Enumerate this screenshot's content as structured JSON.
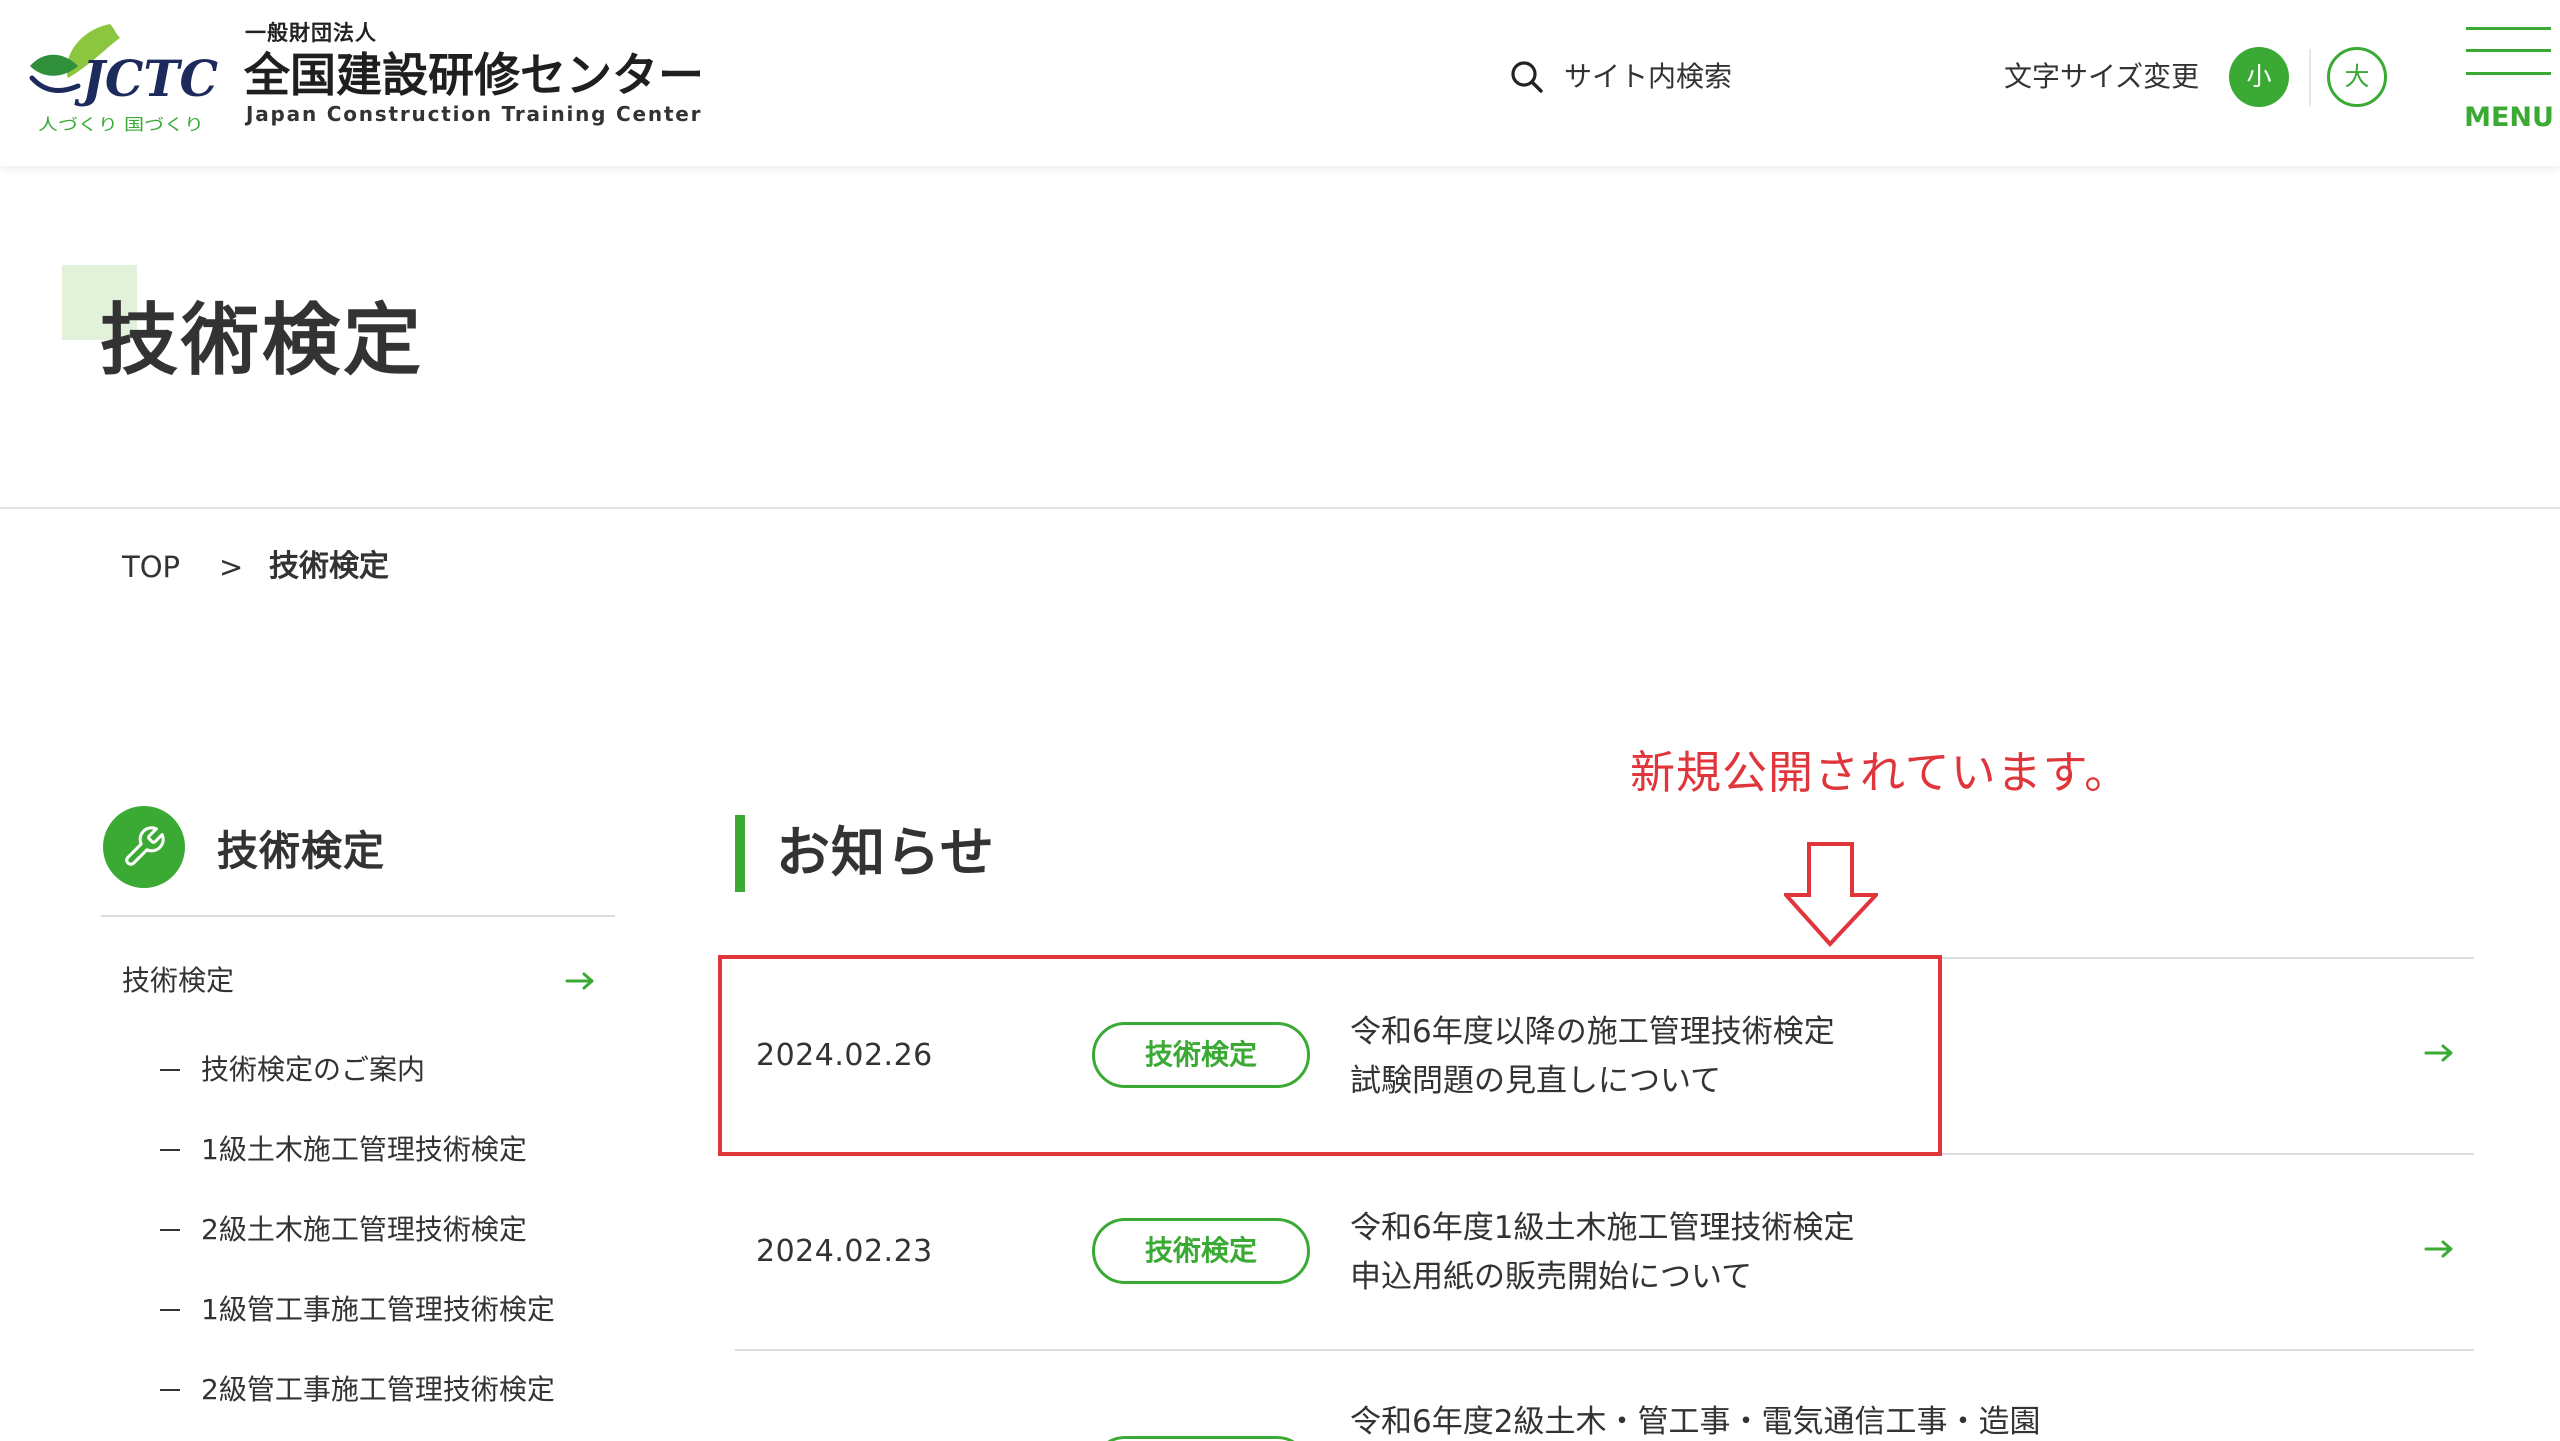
{
  "header": {
    "logo": {
      "mark": "JCTC",
      "tagline": "人づくり 国づくり",
      "org_type": "一般財団法人",
      "org_name": "全国建設研修センター",
      "org_name_en": "Japan Construction Training Center"
    },
    "search": {
      "icon": "search-icon",
      "label": "サイト内検索"
    },
    "text_size": {
      "label": "文字サイズ変更",
      "small": "小",
      "large": "大",
      "small_active": true
    },
    "menu": {
      "icon": "hamburger-icon",
      "label": "MENU"
    }
  },
  "page": {
    "title": "技術検定"
  },
  "breadcrumb": {
    "home": "TOP",
    "separator": ">",
    "current": "技術検定"
  },
  "annotation": {
    "text": "新規公開されています。",
    "icon": "down-arrow-outline-icon"
  },
  "sidebar": {
    "icon": "wrench-icon",
    "heading": "技術検定",
    "top_link": {
      "label": "技術検定",
      "icon": "arrow-right-icon"
    },
    "sub_links": [
      {
        "label": "技術検定のご案内"
      },
      {
        "label": "1級土木施工管理技術検定"
      },
      {
        "label": "2級土木施工管理技術検定"
      },
      {
        "label": "1級管工事施工管理技術検定"
      },
      {
        "label": "2級管工事施工管理技術検定"
      }
    ]
  },
  "news": {
    "heading": "お知らせ",
    "items": [
      {
        "date": "2024.02.26",
        "category": "技術検定",
        "title": [
          "令和6年度以降の施工管理技術検定",
          "試験問題の見直しについて"
        ],
        "icon": "arrow-right-icon",
        "highlighted": true
      },
      {
        "date": "2024.02.23",
        "category": "技術検定",
        "title": [
          "令和6年度1級土木施工管理技術検定",
          "申込用紙の販売開始について"
        ],
        "icon": "arrow-right-icon",
        "highlighted": false
      },
      {
        "title": [
          "令和6年度2級土木・管工事・電気通信工事・造園"
        ]
      }
    ]
  },
  "colors": {
    "brand_green": "#3aaa35",
    "logo_light_green": "#8cc63f",
    "logo_navy": "#1d2b5c",
    "title_square": "#e2f2da",
    "annotation_red": "#e0353a",
    "text": "#333333",
    "rule": "#dddddd"
  }
}
